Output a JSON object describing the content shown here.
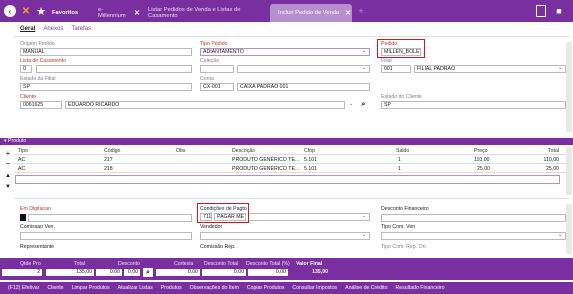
{
  "topbar": {
    "favorites_label": "Favoritos",
    "tabs": [
      {
        "label": "e-Millennium"
      },
      {
        "label": "Listar Pedidos de Venda e Listas de Casamento"
      },
      {
        "label": "Incluir Pedido de Venda"
      }
    ],
    "add_tab": "+"
  },
  "subtabs": [
    "Geral",
    "Anexos",
    "Tarefas"
  ],
  "form": {
    "origem_pedido": {
      "label": "Origem Pedido",
      "value": "MANUAL"
    },
    "tipo_pedido": {
      "label": "Tipo Pedido",
      "value": "ADIANTAMENTO"
    },
    "pedido": {
      "label": "Pedido",
      "value": "MILLEN_BOLETO"
    },
    "lista_casamento": {
      "label": "Lista de Casamento",
      "value": "0"
    },
    "colecao": {
      "label": "Coleção",
      "value": ""
    },
    "filial": {
      "label": "Filial",
      "code": "001",
      "name": "FILIAL PADRÃO"
    },
    "estado_filial": {
      "label": "Estado da Filial",
      "value": "SP"
    },
    "conta": {
      "label": "Conta",
      "code": "CX-001",
      "name": "CAIXA PADRÃO 001"
    },
    "cliente": {
      "label": "Cliente",
      "code": "0061625",
      "name": "EDUARDO RICARDO"
    },
    "estado_cliente": {
      "label": "Estado do Cliente",
      "value": "SP"
    }
  },
  "produtos": {
    "section_label": "Produto",
    "columns": [
      "Tipo",
      "Código",
      "Obs",
      "Descrição",
      "Cfop",
      "Saldo",
      "Preço",
      "Total"
    ],
    "rows": [
      {
        "tipo": "AC",
        "codigo": "217",
        "obs": "",
        "descricao": "PRODUTO GENÉRICO TE...",
        "cfop": "5.101",
        "saldo": "1",
        "preco": "110,00",
        "total": "110,00"
      },
      {
        "tipo": "AC",
        "codigo": "218",
        "obs": "",
        "descricao": "PRODUTO GENÉRICO TE...",
        "cfop": "5.101",
        "saldo": "1",
        "preco": "25,00",
        "total": "25,00"
      }
    ]
  },
  "lower": {
    "em_digitacao": {
      "label": "Em Digitacao"
    },
    "condicoes": {
      "label": "Condições de Pagto",
      "code": "711",
      "name": "PAGAR ME"
    },
    "desconto_financeiro": {
      "label": "Desconto Financeiro",
      "value": ""
    },
    "comissao_ven": {
      "label": "Comissao Ven.",
      "value": ""
    },
    "vendedor": {
      "label": "Vendedor",
      "value": ""
    },
    "tipo_com_ven": {
      "label": "Tipo Com. Ven",
      "value": ""
    },
    "representante": {
      "label": "Representante"
    },
    "comissao_rep": {
      "label": "Comissão Rep."
    },
    "tipo_com_rep": {
      "label": "Tipo Com. Rep. Ori."
    }
  },
  "status": {
    "qtde_pro": {
      "label": "Qtde Pro",
      "value": "2"
    },
    "total": {
      "label": "Total",
      "value": "135,00"
    },
    "desconto": {
      "label": "Desconto",
      "value": "0,00"
    },
    "desconto_pct": {
      "value": "0,00"
    },
    "cortesia": {
      "label": "Cortesia",
      "value": "0,00"
    },
    "desconto_total": {
      "label": "Desconto Total",
      "value": "0,00"
    },
    "desconto_total_pct": {
      "label": "Desconto Total (%)",
      "value": "0,00"
    },
    "valor_final": {
      "label": "Valor Final",
      "value": "135,00"
    }
  },
  "bottombar": [
    "(F12) Efetivar",
    "Cliente",
    "Limpar Produtos",
    "Atualizar Listas",
    "Produtos",
    "Observações do Item",
    "Copiar Produtos",
    "Consultar Impostos",
    "Análise de Crédito",
    "Resultado Financeiro"
  ],
  "colors": {
    "brand": "#7a2fa0",
    "highlight": "#d8141c"
  }
}
